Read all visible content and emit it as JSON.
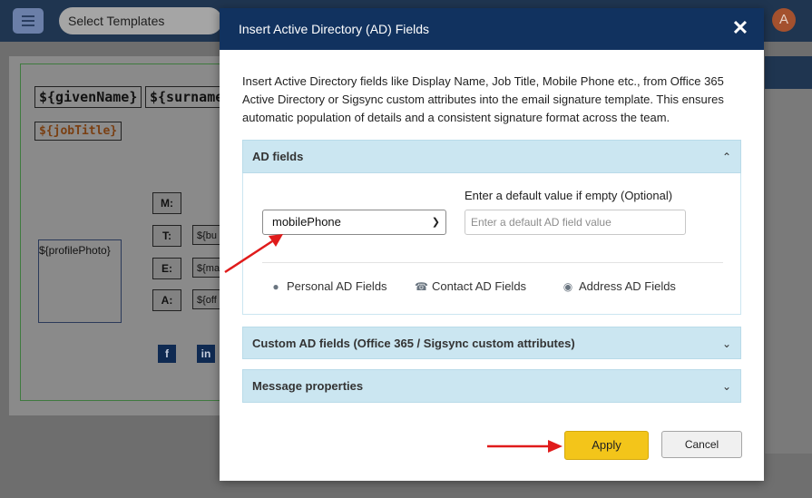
{
  "app": {
    "template_select": "Select Templates",
    "avatar_initial": "A"
  },
  "editor": {
    "given_name": "${givenName}",
    "surname": "${surname",
    "job_title": "${jobTitle}",
    "profile_photo": "${profilePhoto}",
    "contact_labels": [
      "M:",
      "T:",
      "E:",
      "A:"
    ],
    "contact_values": [
      "${bu",
      "${ma",
      "${off"
    ],
    "social_icons": [
      "f",
      "in"
    ]
  },
  "modal": {
    "title": "Insert Active Directory (AD) Fields",
    "close": "✕",
    "intro": "Insert Active Directory fields like Display Name, Job Title, Mobile Phone etc., from Office 365 Active Directory or Sigsync custom attributes into the email signature template. This ensures automatic population of details and a consistent signature format across the team.",
    "sections": [
      {
        "title": "AD fields",
        "expanded": true
      },
      {
        "title": "Custom AD fields (Office 365 / Sigsync custom attributes)",
        "expanded": false
      },
      {
        "title": "Message properties",
        "expanded": false
      }
    ],
    "ad_fields": {
      "selected_field": "mobilePhone",
      "default_label": "Enter a default value if empty (Optional)",
      "default_placeholder": "Enter a default AD field value",
      "links": [
        "Personal AD Fields",
        "Contact AD Fields",
        "Address AD Fields"
      ]
    },
    "apply_label": "Apply",
    "cancel_label": "Cancel"
  },
  "colors": {
    "header": "#11325f",
    "accordion": "#cbe6f1",
    "apply": "#f3c51a",
    "annotation_arrow": "#e01b1b"
  }
}
